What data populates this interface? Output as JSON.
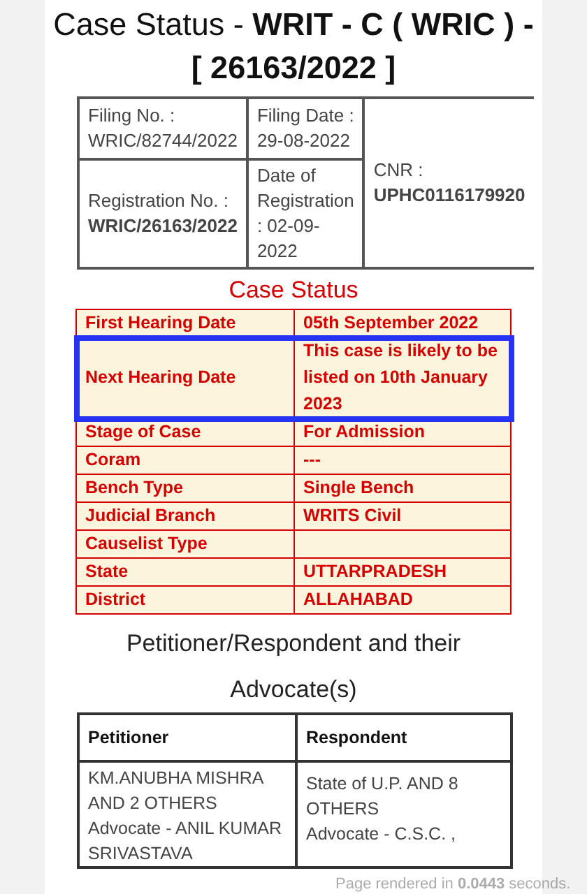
{
  "title": {
    "prefix": "Case Status - ",
    "case_type": "WRIT - C ( WRIC ) - [ 26163/2022 ]"
  },
  "case_info": {
    "filing_no_label": "Filing No. :",
    "filing_no": "WRIC/82744/2022",
    "filing_date_label": "Filing Date :",
    "filing_date": "29-08-2022",
    "registration_no_label": "Registration No. :",
    "registration_no": "WRIC/26163/2022",
    "registration_date_label": "Date of Registration : 02-09-2022",
    "cnr_label": "CNR :",
    "cnr": "UPHC0116179920"
  },
  "case_status": {
    "heading": "Case Status",
    "rows": [
      {
        "label": "First Hearing Date",
        "value": "05th September 2022",
        "highlighted": false
      },
      {
        "label": "Next Hearing Date",
        "value": "This case is likely to be listed on 10th January 2023",
        "highlighted": true
      },
      {
        "label": "Stage of Case",
        "value": "For Admission",
        "highlighted": false
      },
      {
        "label": "Coram",
        "value": "---",
        "highlighted": false
      },
      {
        "label": "Bench Type",
        "value": "Single Bench",
        "highlighted": false
      },
      {
        "label": "Judicial Branch",
        "value": "WRITS Civil",
        "highlighted": false
      },
      {
        "label": "Causelist Type",
        "value": "",
        "highlighted": false
      },
      {
        "label": "State",
        "value": "UTTARPRADESH",
        "highlighted": false
      },
      {
        "label": "District",
        "value": "ALLAHABAD",
        "highlighted": false
      }
    ]
  },
  "parties": {
    "heading": "Petitioner/Respondent and their Advocate(s)",
    "columns": [
      "Petitioner",
      "Respondent"
    ],
    "petitioner": [
      "KM.ANUBHA MISHRA AND 2 OTHERS",
      "Advocate - ANIL KUMAR SRIVASTAVA"
    ],
    "respondent": [
      "State of U.P. AND 8 OTHERS",
      "Advocate - C.S.C. ,"
    ]
  },
  "footer": {
    "prefix": "Page rendered in ",
    "time": "0.0443",
    "suffix": " seconds."
  }
}
